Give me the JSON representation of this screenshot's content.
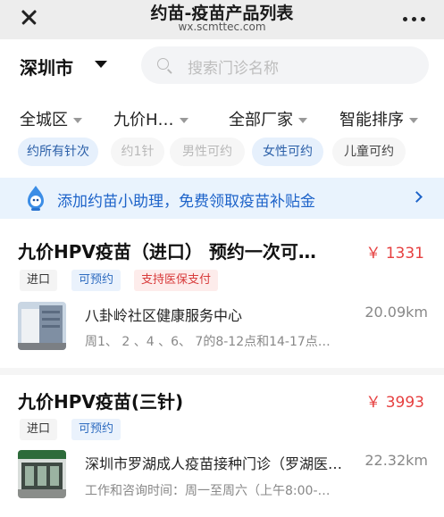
{
  "nav": {
    "title": "约苗-疫苗产品列表",
    "subtitle": "wx.scmttec.com",
    "close_icon": "close-icon",
    "more_icon": "more-icon"
  },
  "location": {
    "city": "深圳市"
  },
  "search": {
    "placeholder": "搜索门诊名称"
  },
  "filters": [
    "全城区",
    "九价H…",
    "全部厂家",
    "智能排序"
  ],
  "chips": [
    "约所有针次",
    "约1针",
    "男性可约",
    "女性可约",
    "儿童可约"
  ],
  "banner": {
    "text": "添加约苗小助理，免费领取疫苗补贴金"
  },
  "products": [
    {
      "title": "九价HPV疫苗（进口） 预约一次可…",
      "price": "￥ 1331",
      "tags": [
        "进口",
        "可预约",
        "支持医保支付"
      ],
      "clinic": "八卦岭社区健康服务中心",
      "distance": "20.09km",
      "hours": "周1、 2 、4 、6、 7的8-12点和14-17点…"
    },
    {
      "title": "九价HPV疫苗(三针)",
      "price": "￥ 3993",
      "tags": [
        "进口",
        "可预约"
      ],
      "clinic": "深圳市罗湖成人疫苗接种门诊（罗湖医…",
      "distance": "22.32km",
      "hours": "工作和咨询时间：周一至周六（上午8:00-…"
    }
  ],
  "colors": {
    "accent": "#1d63c9",
    "price": "#e64040",
    "chip_active_bg": "#e6f0fc"
  }
}
